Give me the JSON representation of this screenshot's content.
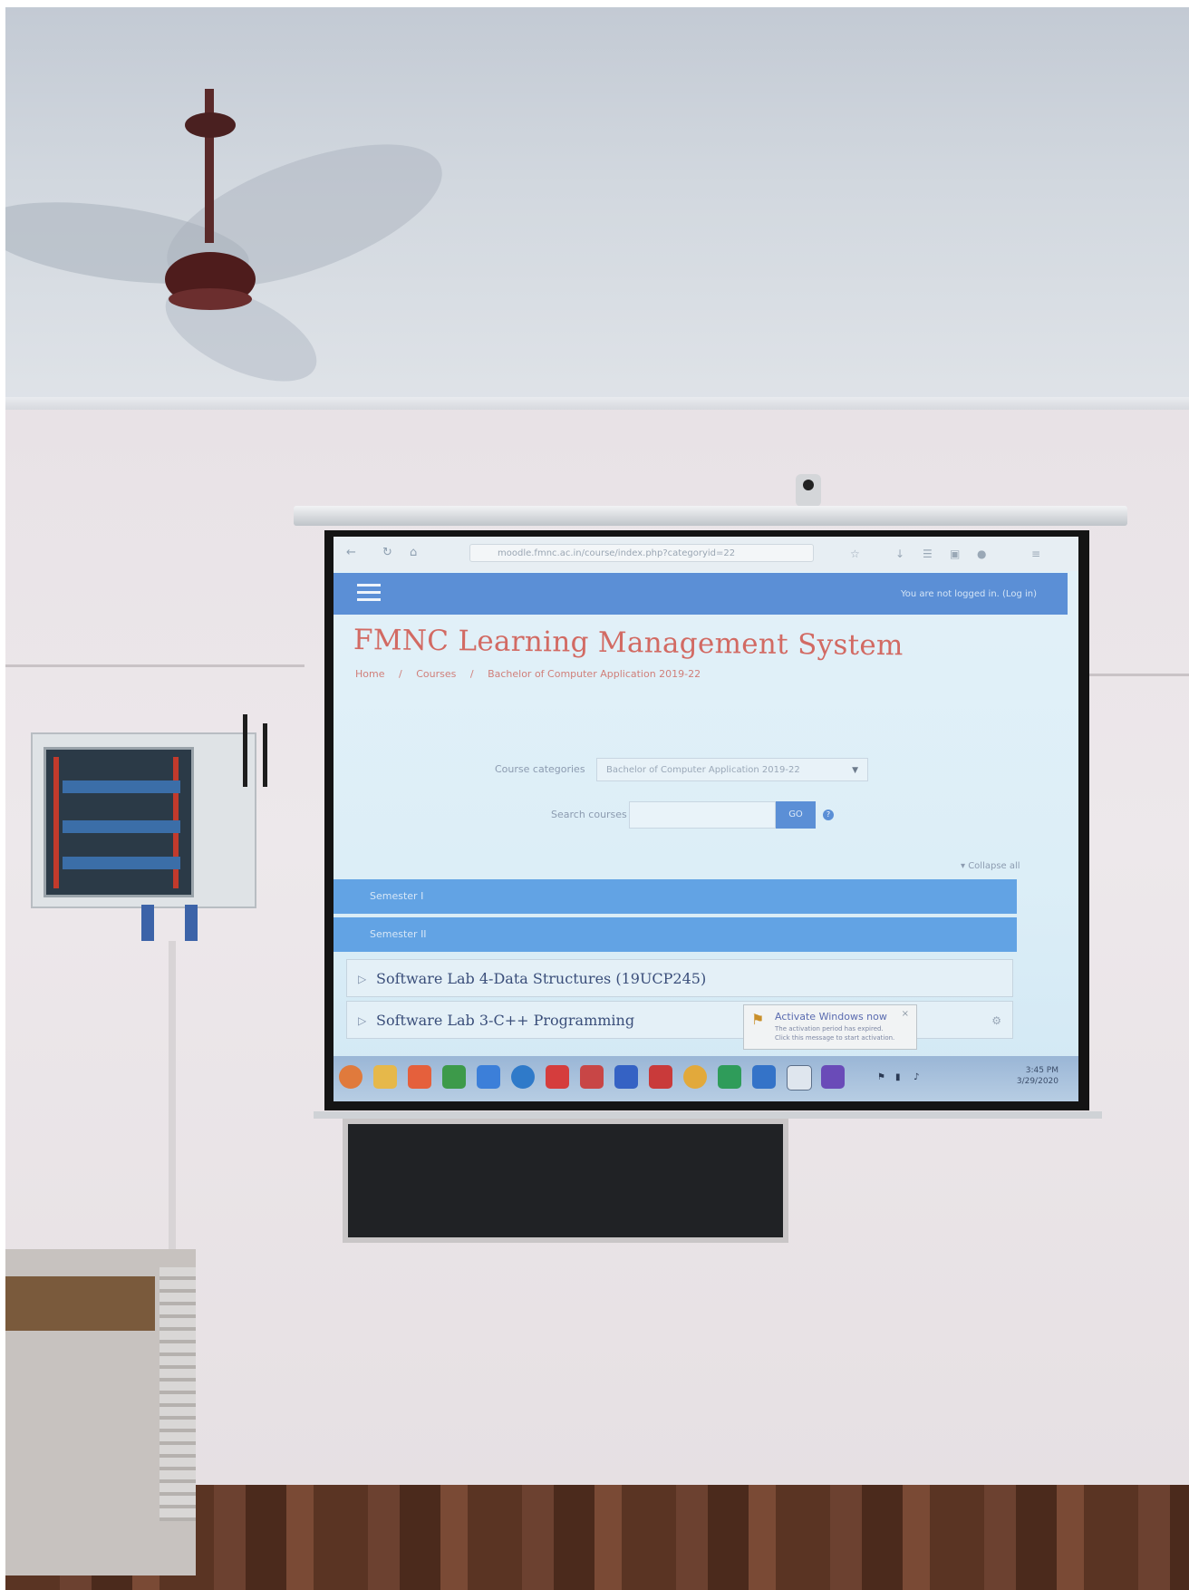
{
  "browser": {
    "url": "moodle.fmnc.ac.in/course/index.php?categoryid=22"
  },
  "site": {
    "title": "FMNC Learning Management System",
    "login_text": "You are not logged in. (Log in)"
  },
  "breadcrumb": [
    "Home",
    "/",
    "Courses",
    "/",
    "Bachelor of Computer Application 2019-22"
  ],
  "course_categories": {
    "label": "Course categories",
    "selected": "Bachelor of Computer Application 2019-22"
  },
  "search": {
    "label": "Search courses",
    "value": "",
    "go_label": "GO"
  },
  "collapse_all": "Collapse all",
  "semesters": [
    {
      "label": "Semester I"
    },
    {
      "label": "Semester II"
    }
  ],
  "courses": [
    {
      "label": "Software Lab 4-Data Structures (19UCP245)"
    },
    {
      "label": "Software Lab 3-C++ Programming"
    }
  ],
  "activation_toast": {
    "title": "Activate Windows now",
    "line1": "The activation period has expired.",
    "line2": "Click this message to start activation."
  },
  "taskbar": {
    "time": "3:45 PM",
    "date": "3/29/2020"
  },
  "icons": [
    "back-icon",
    "refresh-icon",
    "home-icon",
    "hamburger-icon",
    "chevron-down-icon",
    "help-icon",
    "gear-icon",
    "windows-start-icon"
  ],
  "colors": {
    "navbar": "#5b8fd6",
    "title_red": "#d26a63",
    "section_blue": "#62a3e4"
  }
}
